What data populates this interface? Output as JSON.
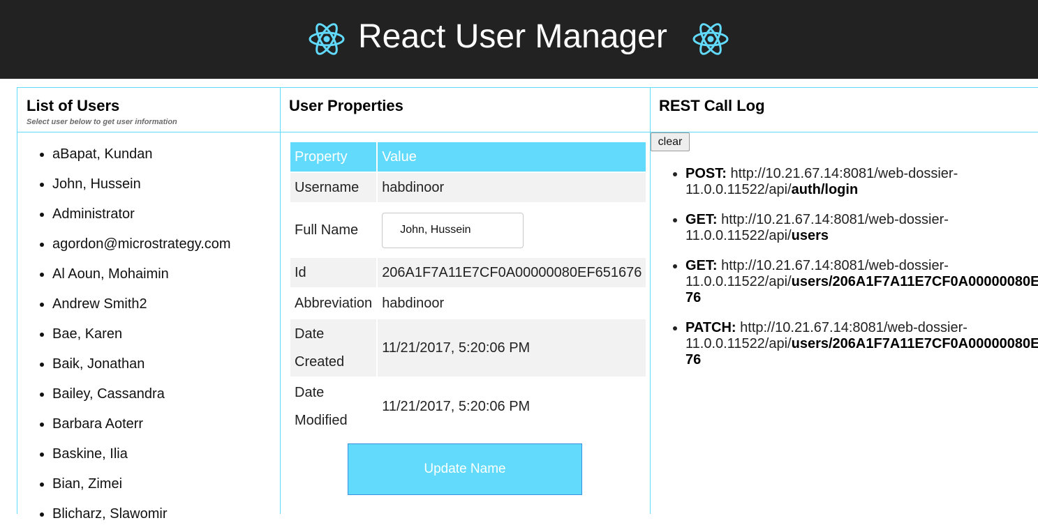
{
  "app": {
    "title": "React User Manager",
    "accent_color": "#61dafb",
    "header_bg": "#222222",
    "logo_icon": "react-atom-icon"
  },
  "users_panel": {
    "title": "List of Users",
    "subtitle": "Select user below to get user information",
    "users": [
      "aBapat, Kundan",
      "John, Hussein",
      "Administrator",
      "agordon@microstrategy.com",
      "Al Aoun, Mohaimin",
      "Andrew Smith2",
      "Bae, Karen",
      "Baik, Jonathan",
      "Bailey, Cassandra",
      "Barbara Aoterr",
      "Baskine, Ilia",
      "Bian, Zimei",
      "Blicharz, Slawomir"
    ]
  },
  "properties_panel": {
    "title": "User Properties",
    "header_property": "Property",
    "header_value": "Value",
    "username_label": "Username",
    "username_value": "habdinoor",
    "fullname_label": "Full Name",
    "fullname_value": "John, Hussein",
    "id_label": "Id",
    "id_value": "206A1F7A11E7CF0A00000080EF651676",
    "abbreviation_label": "Abbreviation",
    "abbreviation_value": "habdinoor",
    "date_created_label_1": "Date",
    "date_created_label_2": "Created",
    "date_created_value": "11/21/2017, 5:20:06 PM",
    "date_modified_label_1": "Date",
    "date_modified_label_2": "Modified",
    "date_modified_value": "11/21/2017, 5:20:06 PM",
    "update_button": "Update Name"
  },
  "log_panel": {
    "title": "REST Call Log",
    "clear_button": "clear",
    "entries": [
      {
        "method": "POST:",
        "base1": "http://10.21.67.14:8081/web-dossier-",
        "base2": "11.0.0.11522/api/",
        "path": "auth/login",
        "path_cont": ""
      },
      {
        "method": "GET:",
        "base1": "http://10.21.67.14:8081/web-dossier-",
        "base2": "11.0.0.11522/api/",
        "path": "users",
        "path_cont": ""
      },
      {
        "method": "GET:",
        "base1": "http://10.21.67.14:8081/web-dossier-",
        "base2": "11.0.0.11522/api/",
        "path": "users/206A1F7A11E7CF0A00000080E",
        "path_cont": "76"
      },
      {
        "method": "PATCH:",
        "base1": "http://10.21.67.14:8081/web-dossier-",
        "base2": "11.0.0.11522/api/",
        "path": "users/206A1F7A11E7CF0A00000080E",
        "path_cont": "76"
      }
    ]
  }
}
